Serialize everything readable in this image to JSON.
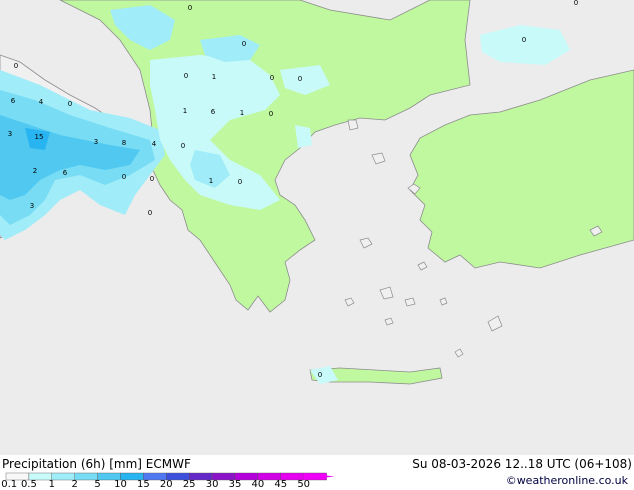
{
  "footer": {
    "title_left": "Precipitation (6h) [mm] ECMWF",
    "title_right": "Su 08-03-2026 12..18 UTC (06+108)",
    "credit": "©weatheronline.co.uk"
  },
  "legend": {
    "ticks": [
      "0.1",
      "0.5",
      "1",
      "2",
      "5",
      "10",
      "15",
      "20",
      "25",
      "30",
      "35",
      "40",
      "45",
      "50"
    ],
    "colors": [
      "#f8f8f8",
      "#c8fafa",
      "#a0ecf8",
      "#78dcf4",
      "#50c8f0",
      "#28b4f0",
      "#5078f0",
      "#3c50dc",
      "#6428c8",
      "#8c14c8",
      "#b400dc",
      "#d200e6",
      "#e600f0",
      "#f000f8"
    ]
  },
  "map_labels": [
    {
      "text": "0"
    },
    {
      "text": "0"
    },
    {
      "text": "6"
    },
    {
      "text": "4"
    },
    {
      "text": "0"
    },
    {
      "text": "3"
    },
    {
      "text": "15"
    },
    {
      "text": "3"
    },
    {
      "text": "8"
    },
    {
      "text": "4"
    },
    {
      "text": "2"
    },
    {
      "text": "6"
    },
    {
      "text": "3"
    },
    {
      "text": "0"
    },
    {
      "text": "0"
    },
    {
      "text": "0"
    },
    {
      "text": "0"
    },
    {
      "text": "1"
    },
    {
      "text": "0"
    },
    {
      "text": "1"
    },
    {
      "text": "6"
    },
    {
      "text": "1"
    },
    {
      "text": "0"
    },
    {
      "text": "0"
    },
    {
      "text": "0"
    },
    {
      "text": "1"
    },
    {
      "text": "0"
    },
    {
      "text": "0"
    },
    {
      "text": "0"
    },
    {
      "text": "0"
    },
    {
      "text": "0"
    }
  ]
}
